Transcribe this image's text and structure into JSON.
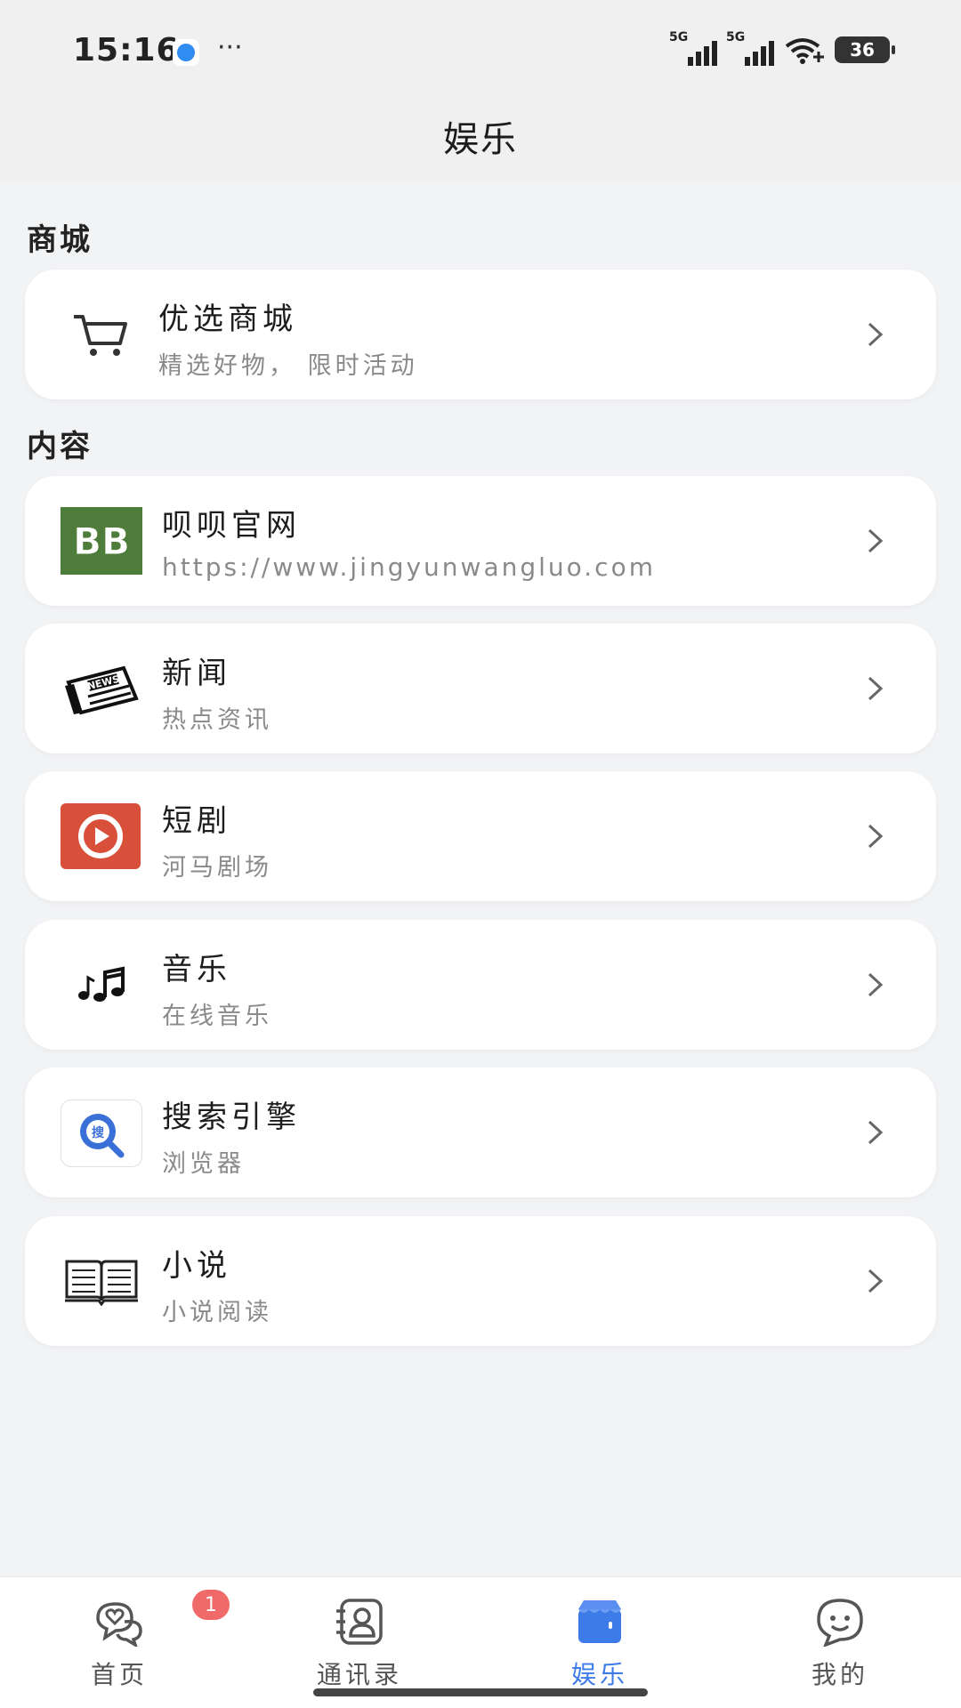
{
  "status_bar": {
    "time": "15:16",
    "more": "···",
    "signal_1": "5G",
    "signal_2": "5G",
    "battery": "36"
  },
  "header": {
    "title": "娱乐"
  },
  "sections": [
    {
      "label": "商城"
    },
    {
      "label": "内容"
    }
  ],
  "items": [
    {
      "title": "优选商城",
      "subtitle": "精选好物， 限时活动",
      "icon": "cart-icon"
    },
    {
      "title": "呗呗官网",
      "subtitle": "https://www.jingyunwangluo.com",
      "icon": "beibei-logo-icon"
    },
    {
      "title": "新闻",
      "subtitle": "热点资讯",
      "icon": "newspaper-icon"
    },
    {
      "title": "短剧",
      "subtitle": "河马剧场",
      "icon": "video-play-icon"
    },
    {
      "title": "音乐",
      "subtitle": "在线音乐",
      "icon": "music-notes-icon"
    },
    {
      "title": "搜索引擎",
      "subtitle": "浏览器",
      "icon": "search-engine-icon"
    },
    {
      "title": "小说",
      "subtitle": "小说阅读",
      "icon": "book-icon"
    }
  ],
  "nav": {
    "items": [
      {
        "label": "首页",
        "icon": "chat-heart-icon",
        "badge": "1"
      },
      {
        "label": "通讯录",
        "icon": "contacts-icon"
      },
      {
        "label": "娱乐",
        "icon": "store-icon",
        "active": true
      },
      {
        "label": "我的",
        "icon": "smile-bubble-icon"
      }
    ]
  },
  "colors": {
    "accent": "#3d7be8",
    "badge": "#f06a6a",
    "beibei_green": "#4e7d3b",
    "drama_red": "#d9503a",
    "search_blue": "#3a6fd8"
  }
}
